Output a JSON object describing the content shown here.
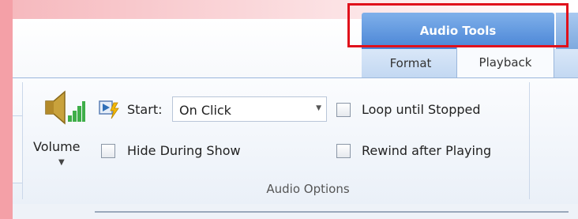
{
  "contextual_tab": {
    "title": "Audio Tools",
    "tabs": [
      {
        "label": "Format"
      },
      {
        "label": "Playback",
        "active": true
      }
    ]
  },
  "ribbon": {
    "volume": {
      "label": "Volume",
      "icon": "speaker-icon"
    },
    "start": {
      "label": "Start:",
      "value": "On Click",
      "icon": "play-animation-icon"
    },
    "options": {
      "loop": {
        "label": "Loop until Stopped",
        "checked": false
      },
      "hide": {
        "label": "Hide During Show",
        "checked": false
      },
      "rewind": {
        "label": "Rewind after Playing",
        "checked": false
      }
    },
    "group_label": "Audio Options"
  },
  "colors": {
    "highlight": "#e0101b",
    "context_header": "#4a85d6",
    "left_strip": "#f4a0a7"
  }
}
